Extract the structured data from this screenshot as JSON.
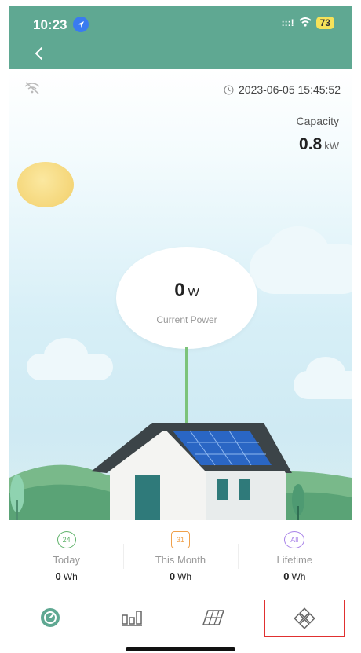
{
  "status_bar": {
    "time": "10:23",
    "signal": ":::!",
    "battery": "73"
  },
  "header": {
    "back_icon": "chevron-left-icon"
  },
  "hero": {
    "timestamp": "2023-06-05 15:45:52",
    "capacity_label": "Capacity",
    "capacity_value": "0.8",
    "capacity_unit": "kW",
    "current_power_value": "0",
    "current_power_unit": "W",
    "current_power_label": "Current Power"
  },
  "stats": [
    {
      "icon_text": "24",
      "label": "Today",
      "value": "0",
      "unit": "Wh",
      "color": "#5fb26a"
    },
    {
      "icon_text": "31",
      "label": "This Month",
      "value": "0",
      "unit": "Wh",
      "color": "#f0a04a"
    },
    {
      "icon_text": "All",
      "label": "Lifetime",
      "value": "0",
      "unit": "Wh",
      "color": "#a882e8"
    }
  ],
  "tabs": [
    {
      "icon": "gauge-icon"
    },
    {
      "icon": "bar-chart-icon"
    },
    {
      "icon": "solar-panel-icon"
    },
    {
      "icon": "device-icon",
      "selected": true
    }
  ],
  "colors": {
    "header_bg": "#5fa892",
    "accent": "#5fa892",
    "selected_outline": "#e03030"
  }
}
